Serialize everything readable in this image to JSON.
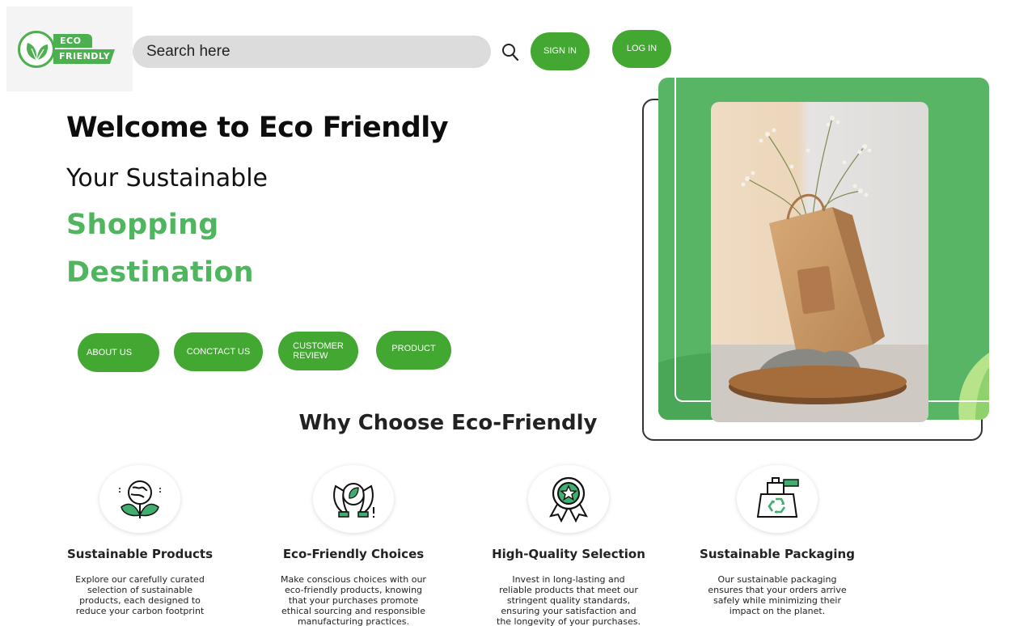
{
  "logo": {
    "line1": "ECO",
    "line2": "FRIENDLY"
  },
  "search": {
    "placeholder": "Search here"
  },
  "header": {
    "signin_label": "SIGN IN",
    "login_label": "LOG IN"
  },
  "hero": {
    "title": "Welcome to Eco Friendly",
    "subtitle": "Your Sustainable",
    "highlight_line1": "Shopping",
    "highlight_line2": "Destination"
  },
  "nav": {
    "about": "ABOUT US",
    "contact": "CONCTACT US",
    "review_line1": "CUSTOMER",
    "review_line2": "REVIEW",
    "product": "PRODUCT"
  },
  "section": {
    "title": "Why Choose Eco-Friendly"
  },
  "features": [
    {
      "title": "Sustainable Products",
      "icon": "globe-leaf-icon",
      "text": "Explore our carefully curated selection of sustainable products, each designed to reduce your carbon footprint"
    },
    {
      "title": "Eco-Friendly Choices",
      "icon": "hands-leaf-icon",
      "text": "Make conscious choices with our eco-friendly products, knowing that your purchases promote ethical sourcing and responsible manufacturing practices."
    },
    {
      "title": "High-Quality Selection",
      "icon": "award-badge-icon",
      "text": "Invest in long-lasting and reliable products that meet our stringent quality standards, ensuring your satisfaction and the longevity of your purchases."
    },
    {
      "title": "Sustainable Packaging",
      "icon": "recycle-box-icon",
      "text": "Our sustainable packaging ensures that your orders arrive safely while minimizing their impact on the planet."
    }
  ],
  "colors": {
    "brand_green": "#43a832",
    "accent_green": "#4fb55f",
    "panel_green": "#58b566"
  }
}
